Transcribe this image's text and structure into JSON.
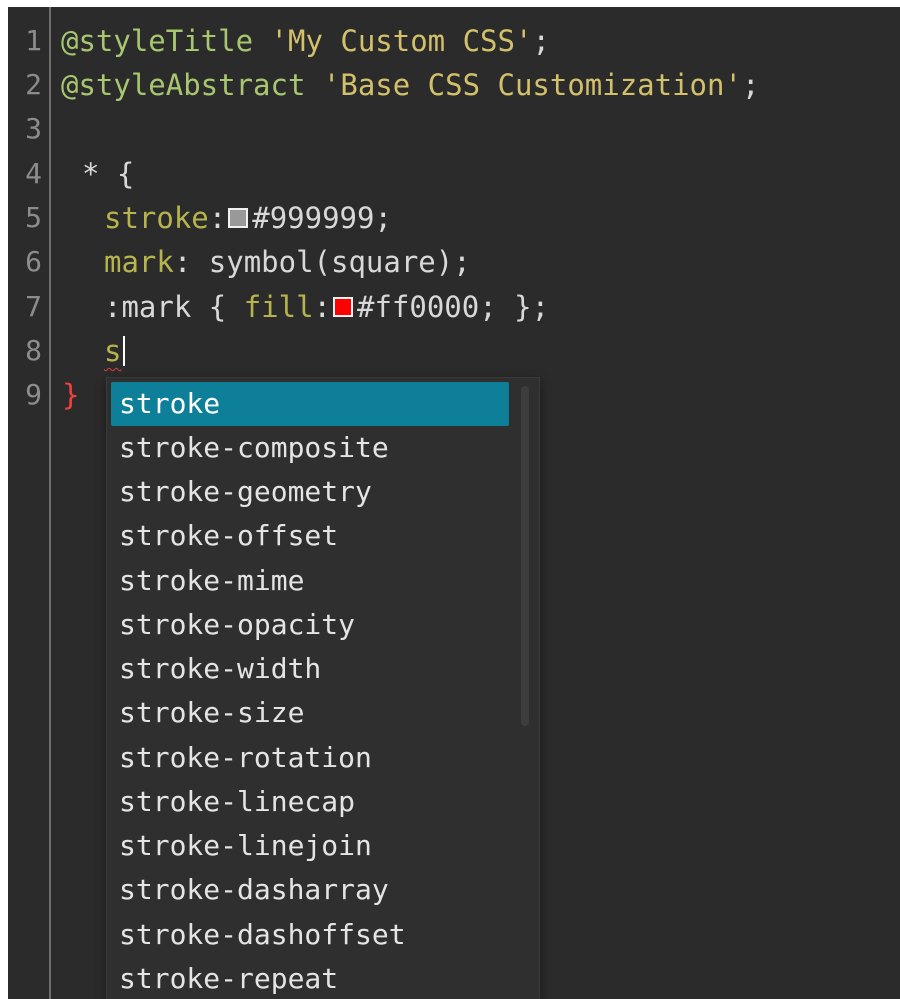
{
  "editor": {
    "line_numbers": [
      "1",
      "2",
      "3",
      "4",
      "5",
      "6",
      "7",
      "8",
      "9"
    ],
    "lines": {
      "l1": {
        "keyword": "@styleTitle",
        "string": "'My Custom CSS'",
        "end": ";"
      },
      "l2": {
        "keyword": "@styleAbstract",
        "string": "'Base CSS Customization'",
        "end": ";"
      },
      "l4": {
        "selector": "* {"
      },
      "l5": {
        "prop": "stroke",
        "colon": ":",
        "value": "#999999",
        "end": ";",
        "swatch_color": "#999999"
      },
      "l6": {
        "prop": "mark",
        "colon": ":",
        "value": " symbol(square)",
        "end": ";"
      },
      "l7": {
        "prefix": ":mark { ",
        "prop": "fill",
        "colon": ":",
        "value": "#ff0000",
        "end": "; };",
        "swatch_color": "#ff0000"
      },
      "l8": {
        "typed": "s"
      },
      "l9": {
        "close_brace": "}"
      }
    }
  },
  "autocomplete": {
    "selected_index": 0,
    "items": [
      "stroke",
      "stroke-composite",
      "stroke-geometry",
      "stroke-offset",
      "stroke-mime",
      "stroke-opacity",
      "stroke-width",
      "stroke-size",
      "stroke-rotation",
      "stroke-linecap",
      "stroke-linejoin",
      "stroke-dasharray",
      "stroke-dashoffset",
      "stroke-repeat"
    ],
    "selected_color": "#0e7f99"
  }
}
